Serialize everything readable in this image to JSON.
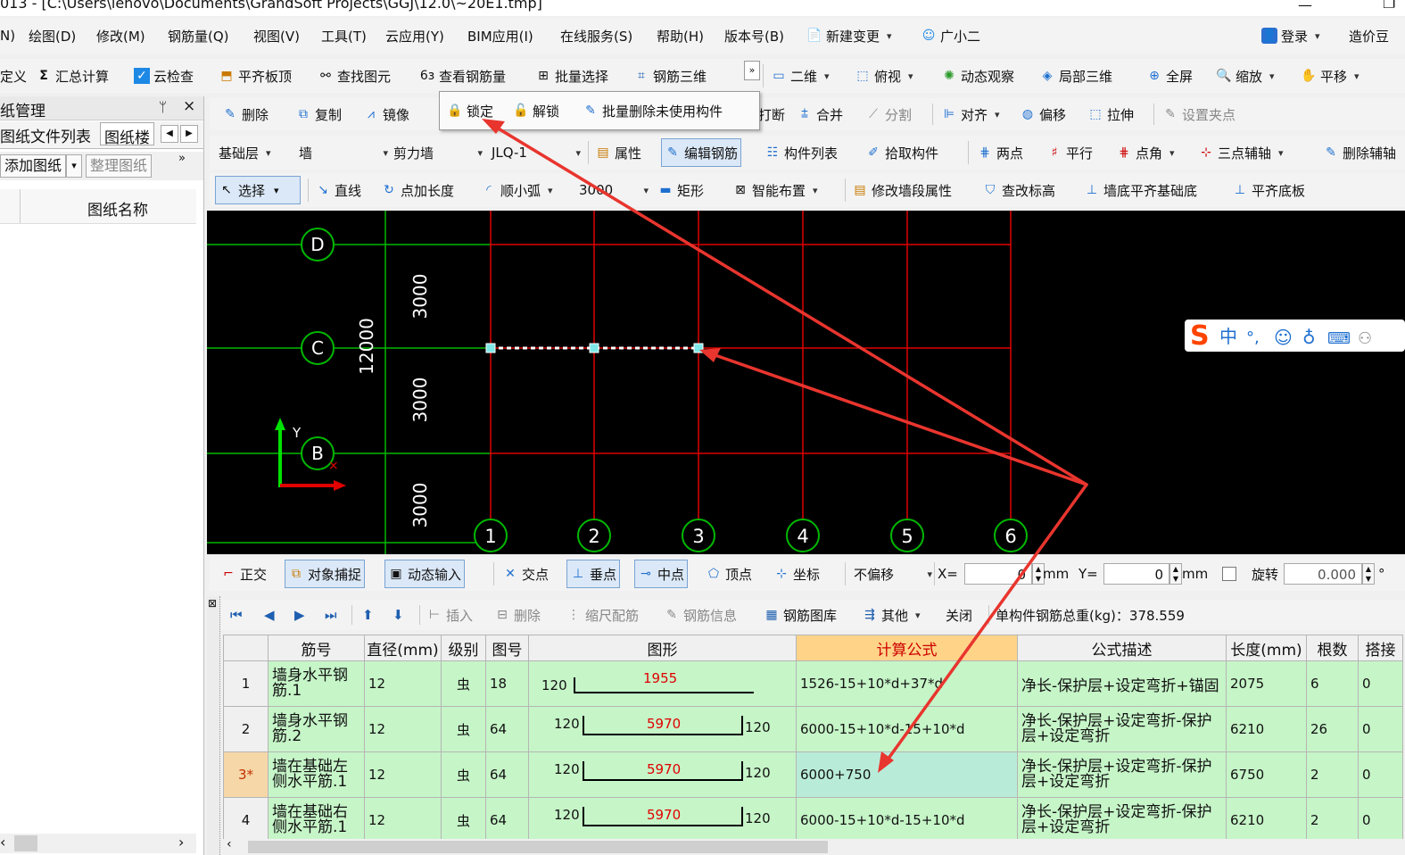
{
  "title_bar": {
    "path": "013 - [C:\\Users\\lenovo\\Documents\\GrandSoft Projects\\GGJ\\12.0\\~20E1.tmp]"
  },
  "menu": {
    "items": [
      "N)",
      "绘图(D)",
      "修改(M)",
      "钢筋量(Q)",
      "视图(V)",
      "工具(T)",
      "云应用(Y)",
      "BIM应用(I)",
      "在线服务(S)",
      "帮助(H)",
      "版本号(B)",
      "新建变更",
      "广小二"
    ],
    "login": "登录",
    "cost": "造价豆"
  },
  "toolbar1": {
    "left": [
      "定义",
      "汇总计算",
      "云检查",
      "平齐板顶",
      "查找图元",
      "查看钢筋量",
      "批量选择",
      "钢筋三维"
    ],
    "right": [
      "二维",
      "俯视",
      "动态观察",
      "局部三维",
      "全屏",
      "缩放",
      "平移"
    ]
  },
  "toolbar2": {
    "items": [
      "删除",
      "复制",
      "镜像"
    ],
    "popup": [
      "锁定",
      "解锁",
      "批量删除未使用构件"
    ],
    "right": [
      "打断",
      "合并",
      "分割",
      "对齐",
      "偏移",
      "拉伸",
      "设置夹点"
    ]
  },
  "toolbar3": {
    "floor": "基础层",
    "type": "墙",
    "subtype": "剪力墙",
    "component": "JLQ-1",
    "items": [
      "属性",
      "编辑钢筋",
      "构件列表",
      "拾取构件",
      "两点",
      "平行",
      "点角",
      "三点辅轴",
      "删除辅轴"
    ]
  },
  "toolbar4": {
    "select": "选择",
    "items": [
      "直线",
      "点加长度",
      "顺小弧"
    ],
    "radius": "3000",
    "more": [
      "矩形",
      "智能布置",
      "修改墙段属性",
      "查改标高",
      "墙底平齐基础底",
      "平齐底板"
    ]
  },
  "left_panel": {
    "title": "纸管理",
    "pin": "ᛘ",
    "close": "×",
    "tabs": [
      "图纸文件列表",
      "图纸楼"
    ],
    "add_button": "添加图纸",
    "tidy_button": "整理图纸",
    "column": "图纸名称"
  },
  "canvas": {
    "row_axes": [
      "D",
      "C",
      "B"
    ],
    "col_axes": [
      "1",
      "2",
      "3",
      "4",
      "5",
      "6"
    ],
    "dims": [
      "3000",
      "3000",
      "3000"
    ],
    "total_dim": "12000",
    "axis_y": "Y",
    "ime": "中"
  },
  "status_bar": {
    "items": [
      "正交",
      "对象捕捉",
      "动态输入",
      "交点",
      "垂点",
      "中点",
      "顶点",
      "坐标"
    ],
    "offset": "不偏移",
    "x_label": "X=",
    "x_value": "0",
    "mm1": "mm",
    "y_label": "Y=",
    "y_value": "0",
    "mm2": "mm",
    "rotate_label": "旋转",
    "rotate_value": "0.000",
    "deg": "°"
  },
  "rebar_toolbar": {
    "items": [
      "插入",
      "删除",
      "缩尺配筋",
      "钢筋信息",
      "钢筋图库",
      "其他",
      "关闭"
    ],
    "total_label": "单构件钢筋总重(kg)：378.559"
  },
  "table": {
    "headers": [
      "筋号",
      "直径(mm)",
      "级别",
      "图号",
      "图形",
      "计算公式",
      "公式描述",
      "长度(mm)",
      "根数",
      "搭接"
    ],
    "rows": [
      {
        "n": "1",
        "name": "墙身水平钢筋.1",
        "dia": "12",
        "grade": "虫",
        "fig": "18",
        "left": "120",
        "mid": "1955",
        "right": "",
        "formula": "1526-15+10*d+37*d",
        "desc": "净长-保护层+设定弯折+锚固",
        "len": "2075",
        "count": "6",
        "lap": "0"
      },
      {
        "n": "2",
        "name": "墙身水平钢筋.2",
        "dia": "12",
        "grade": "虫",
        "fig": "64",
        "left": "120",
        "mid": "5970",
        "right": "120",
        "formula": "6000-15+10*d-15+10*d",
        "desc": "净长-保护层+设定弯折-保护层+设定弯折",
        "len": "6210",
        "count": "26",
        "lap": "0"
      },
      {
        "n": "3*",
        "name": "墙在基础左侧水平筋.1",
        "dia": "12",
        "grade": "虫",
        "fig": "64",
        "left": "120",
        "mid": "5970",
        "right": "120",
        "formula": "6000+750",
        "desc": "净长-保护层+设定弯折-保护层+设定弯折",
        "len": "6750",
        "count": "2",
        "lap": "0"
      },
      {
        "n": "4",
        "name": "墙在基础右侧水平筋.1",
        "dia": "12",
        "grade": "虫",
        "fig": "64",
        "left": "120",
        "mid": "5970",
        "right": "120",
        "formula": "6000-15+10*d-15+10*d",
        "desc": "净长-保护层+设定弯折-保护层+设定弯折",
        "len": "6210",
        "count": "2",
        "lap": "0"
      }
    ]
  }
}
